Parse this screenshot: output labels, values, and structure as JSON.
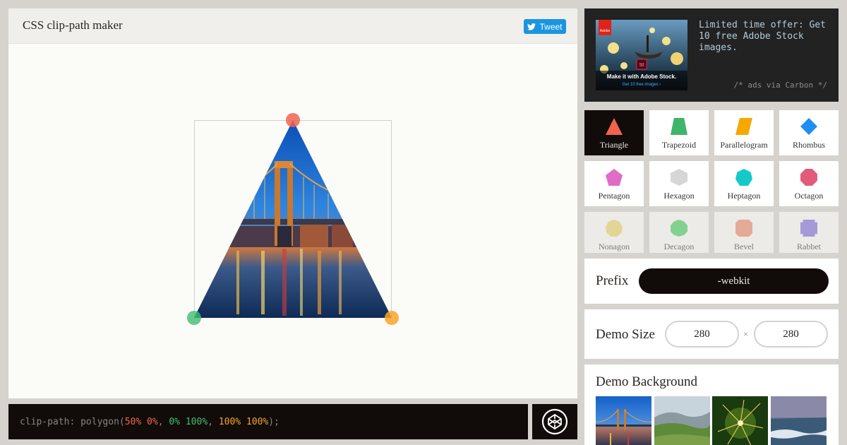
{
  "header": {
    "title": "CSS clip-path maker",
    "tweet_label": "Tweet"
  },
  "code": {
    "property": "clip-path:",
    "func_open": " polygon(",
    "p1": "50% 0%",
    "sep1": ", ",
    "p2": "0% 100%",
    "sep2": ", ",
    "p3": "100% 100%",
    "func_close": ");",
    "colors": {
      "p1": "#f0644e",
      "p2": "#3fbf73",
      "p3": "#f7a428"
    }
  },
  "ad": {
    "image_caption": "Make it with Adobe Stock.",
    "image_subcaption": "Get 10 free images ›",
    "logo_text": "Adobe",
    "stock_badge": "St",
    "text": "Limited time offer: Get 10 free Adobe Stock images.",
    "via": "/* ads via Carbon */"
  },
  "shapes": [
    {
      "label": "Triangle",
      "icon": "triangle-icon",
      "color": "#f0644e",
      "selected": true
    },
    {
      "label": "Trapezoid",
      "icon": "trapezoid-icon",
      "color": "#3fb56a"
    },
    {
      "label": "Parallelogram",
      "icon": "parallelogram-icon",
      "color": "#f7a800"
    },
    {
      "label": "Rhombus",
      "icon": "rhombus-icon",
      "color": "#1f8ef1"
    },
    {
      "label": "Pentagon",
      "icon": "pentagon-icon",
      "color": "#e06cc8"
    },
    {
      "label": "Hexagon",
      "icon": "hexagon-icon",
      "color": "#d6d6d6"
    },
    {
      "label": "Heptagon",
      "icon": "heptagon-icon",
      "color": "#16c9c9"
    },
    {
      "label": "Octagon",
      "icon": "octagon-icon",
      "color": "#e35b7a"
    },
    {
      "label": "Nonagon",
      "icon": "nonagon-icon",
      "color": "#ebd96a"
    },
    {
      "label": "Decagon",
      "icon": "decagon-icon",
      "color": "#3fd05a"
    },
    {
      "label": "Bevel",
      "icon": "bevel-icon",
      "color": "#f08a6a"
    },
    {
      "label": "Rabbet",
      "icon": "rabbet-icon",
      "color": "#7e6be0"
    }
  ],
  "prefix": {
    "label": "Prefix",
    "value": "-webkit"
  },
  "demo_size": {
    "label": "Demo Size",
    "width": "280",
    "height": "280",
    "separator": "×"
  },
  "demo_background": {
    "label": "Demo Background",
    "options": [
      "bridge-night-thumb",
      "green-valley-thumb",
      "sparkler-thumb",
      "sea-shore-thumb"
    ]
  }
}
